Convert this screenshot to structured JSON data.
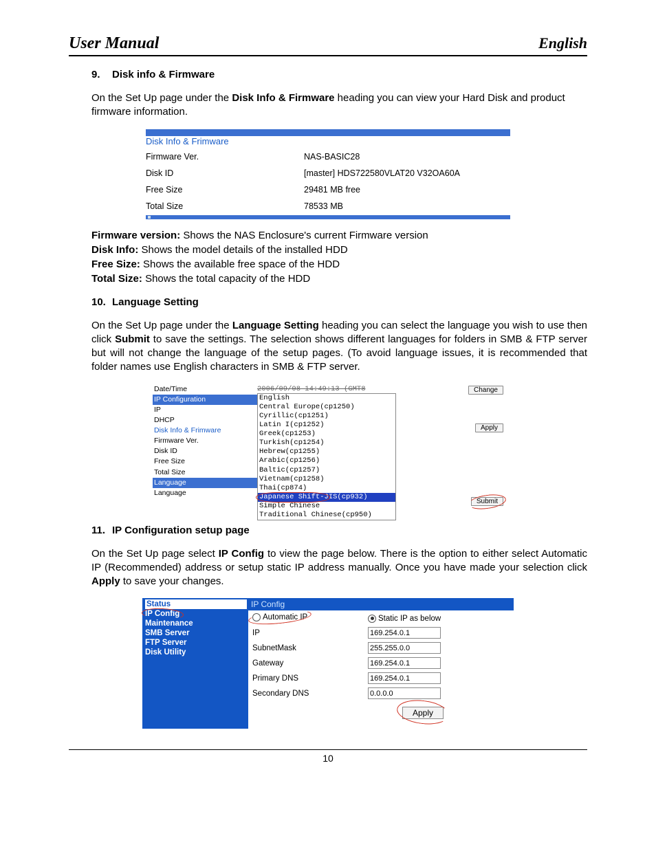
{
  "header": {
    "left": "User Manual",
    "right": "English"
  },
  "sections": {
    "s9": {
      "num": "9.",
      "title": "Disk info & Firmware",
      "p1a": "On the Set Up page under the ",
      "p1b": "Disk Info & Firmware",
      "p1c": " heading you can view your Hard Disk and product firmware information."
    },
    "s10": {
      "num": "10.",
      "title": "Language Setting",
      "p1a": "On the Set Up page under the ",
      "p1b": "Language Setting",
      "p1c": " heading you can select the language you wish to use then click ",
      "p1d": "Submit",
      "p1e": " to save the settings. The selection shows different languages for folders in SMB & FTP server but will not change the language of the setup pages. (To avoid language issues, it is recommended that folder names use English characters in SMB & FTP server."
    },
    "s11": {
      "num": "11.",
      "title": "IP Configuration setup page",
      "p1a": "On the Set Up page select ",
      "p1b": "IP Config",
      "p1c": " to view the page below. There is the option to either select Automatic IP (Recommended) address or setup static IP address manually. Once you have made your selection click ",
      "p1d": "Apply",
      "p1e": " to save your changes."
    }
  },
  "fig1": {
    "title": "Disk Info & Frimware",
    "rows": {
      "fw": {
        "label": "Firmware Ver.",
        "value": "NAS-BASIC28"
      },
      "id": {
        "label": "Disk ID",
        "value": "[master] HDS722580VLAT20 V32OA60A"
      },
      "free": {
        "label": "Free Size",
        "value": "29481 MB free"
      },
      "total": {
        "label": "Total Size",
        "value": "78533 MB"
      }
    }
  },
  "desc": {
    "fw": {
      "label": "Firmware version:",
      "text": " Shows the NAS Enclosure's current Firmware version"
    },
    "id": {
      "label": "Disk Info:",
      "text": " Shows the model details of the installed HDD"
    },
    "free": {
      "label": "Free Size:",
      "text": " Shows the available free space of the HDD"
    },
    "total": {
      "label": "Total Size:",
      "text": " Shows the total capacity of the HDD"
    }
  },
  "fig2": {
    "datetime_label": "Date/Time",
    "datetime_value": "2006/09/08 14:49:13 (GMT8",
    "ipconf_label": "IP Configuration",
    "ip_label": "IP",
    "dhcp_label": "DHCP",
    "diskinfo_label": "Disk Info & Frimware",
    "fw_label": "Firmware Ver.",
    "diskid_label": "Disk ID",
    "free_label": "Free Size",
    "total_label": "Total Size",
    "lang_header": "Language",
    "lang_label": "Language",
    "options": [
      "English",
      "Central Europe(cp1250)",
      "Cyrillic(cp1251)",
      "Latin I(cp1252)",
      "Greek(cp1253)",
      "Turkish(cp1254)",
      "Hebrew(cp1255)",
      "Arabic(cp1256)",
      "Baltic(cp1257)",
      "Vietnam(cp1258)",
      "Thai(cp874)",
      "Japanese Shift-JIS(cp932)",
      "Simple Chinese",
      "Traditional Chinese(cp950)"
    ],
    "selected": "Japanese Shift-JIS(cp932)",
    "btn_change": "Change",
    "btn_apply": "Apply",
    "btn_submit": "Submit"
  },
  "fig3": {
    "sidebar": {
      "status": "Status",
      "ipconfig": "IP Config",
      "maintenance": "Maintenance",
      "smb": "SMB Server",
      "ftp": "FTP Server",
      "disk": "Disk Utility"
    },
    "main_title": "IP Config",
    "auto_label": "Automatic IP",
    "static_label": "Static IP as below",
    "rows": {
      "ip": {
        "label": "IP",
        "value": "169.254.0.1"
      },
      "sm": {
        "label": "SubnetMask",
        "value": "255.255.0.0"
      },
      "gw": {
        "label": "Gateway",
        "value": "169.254.0.1"
      },
      "pd": {
        "label": "Primary DNS",
        "value": "169.254.0.1"
      },
      "sd": {
        "label": "Secondary DNS",
        "value": "0.0.0.0"
      }
    },
    "apply": "Apply"
  },
  "page_number": "10"
}
